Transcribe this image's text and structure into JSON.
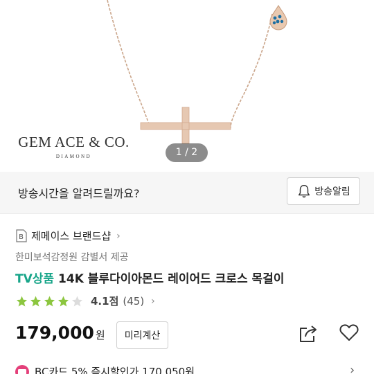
{
  "product_image": {
    "brand_logo_main": "GEM ACE & CO.",
    "brand_logo_sub": "DIAMOND",
    "page_indicator": "1 / 2"
  },
  "broadcast": {
    "question": "방송시간을 알려드릴까요?",
    "alarm_button_label": "방송알림",
    "alarm_icon": "bell-icon"
  },
  "brand": {
    "badge": "B",
    "name": "제메이스 브랜드샵",
    "chevron": "›"
  },
  "appraisal": "한미보석감정원 감별서 제공",
  "title": {
    "tag": "TV상품",
    "name": "14K 블루다이아몬드 레이어드 크로스 목걸이"
  },
  "rating": {
    "stars": 4,
    "score": "4.1점",
    "count": "(45)",
    "chevron": "›"
  },
  "price": {
    "value": "179,000",
    "unit": "원",
    "calc_button_label": "미리계산"
  },
  "actions": {
    "share_icon": "share-icon",
    "wishlist_icon": "heart-icon"
  },
  "card_promo": {
    "text": "BC카드 5% 즉시할인가 170,050원",
    "chevron": "›"
  },
  "colors": {
    "tv_tag": "#17a589",
    "star": "#8cc63f",
    "card_badge": "#e4407a"
  }
}
